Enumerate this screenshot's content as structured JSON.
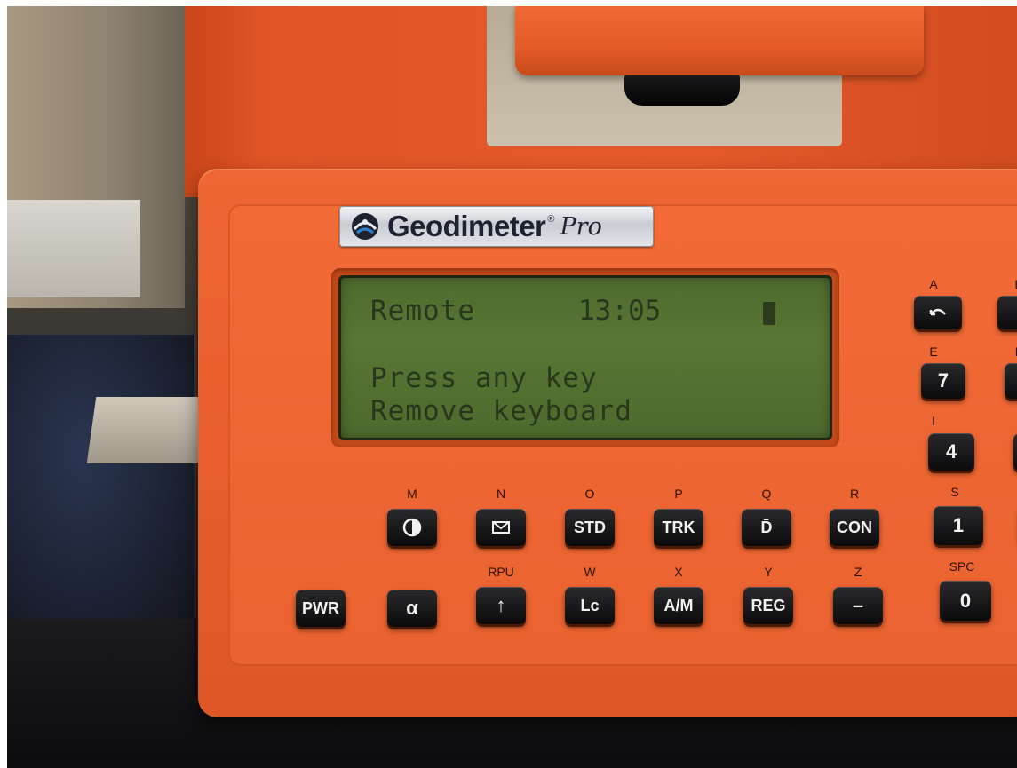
{
  "brand": {
    "name": "Geodimeter",
    "reg": "®",
    "model": "Pro"
  },
  "display": {
    "status": "Remote",
    "time": "13:05",
    "line1": "Press any key",
    "line2": "Remove keyboard"
  },
  "function_keys": [
    {
      "label_above": "M",
      "key": "",
      "icon": "contrast-icon"
    },
    {
      "label_above": "N",
      "key": "",
      "icon": "envelope-icon"
    },
    {
      "label_above": "O",
      "key": "STD",
      "icon": ""
    },
    {
      "label_above": "P",
      "key": "TRK",
      "icon": ""
    },
    {
      "label_above": "Q",
      "key": "D̄",
      "icon": ""
    },
    {
      "label_above": "R",
      "key": "CON",
      "icon": ""
    }
  ],
  "bottom_keys": [
    {
      "label_above": "",
      "key": "PWR",
      "icon": ""
    },
    {
      "label_above": "",
      "key": "α",
      "icon": ""
    },
    {
      "label_above": "RPU",
      "key": "↑",
      "icon": ""
    },
    {
      "label_above": "W",
      "key": "Lc",
      "icon": ""
    },
    {
      "label_above": "X",
      "key": "A/M",
      "icon": ""
    },
    {
      "label_above": "Y",
      "key": "REG",
      "icon": ""
    },
    {
      "label_above": "Z",
      "key": "–",
      "icon": ""
    }
  ],
  "keypad": [
    {
      "label_above": "A",
      "key": "",
      "icon": "arrow-back-icon"
    },
    {
      "label_above": "B",
      "key": "",
      "icon": ""
    },
    {
      "label_above": "E",
      "key": "7"
    },
    {
      "label_above": "F",
      "key": ""
    },
    {
      "label_above": "I",
      "key": "4"
    },
    {
      "label_above": "S",
      "key": "1"
    },
    {
      "label_above": "SPC",
      "key": "0"
    }
  ],
  "colors": {
    "instrument_orange": "#e85f2d",
    "lcd_green": "#5a7634",
    "key_black": "#141416"
  }
}
